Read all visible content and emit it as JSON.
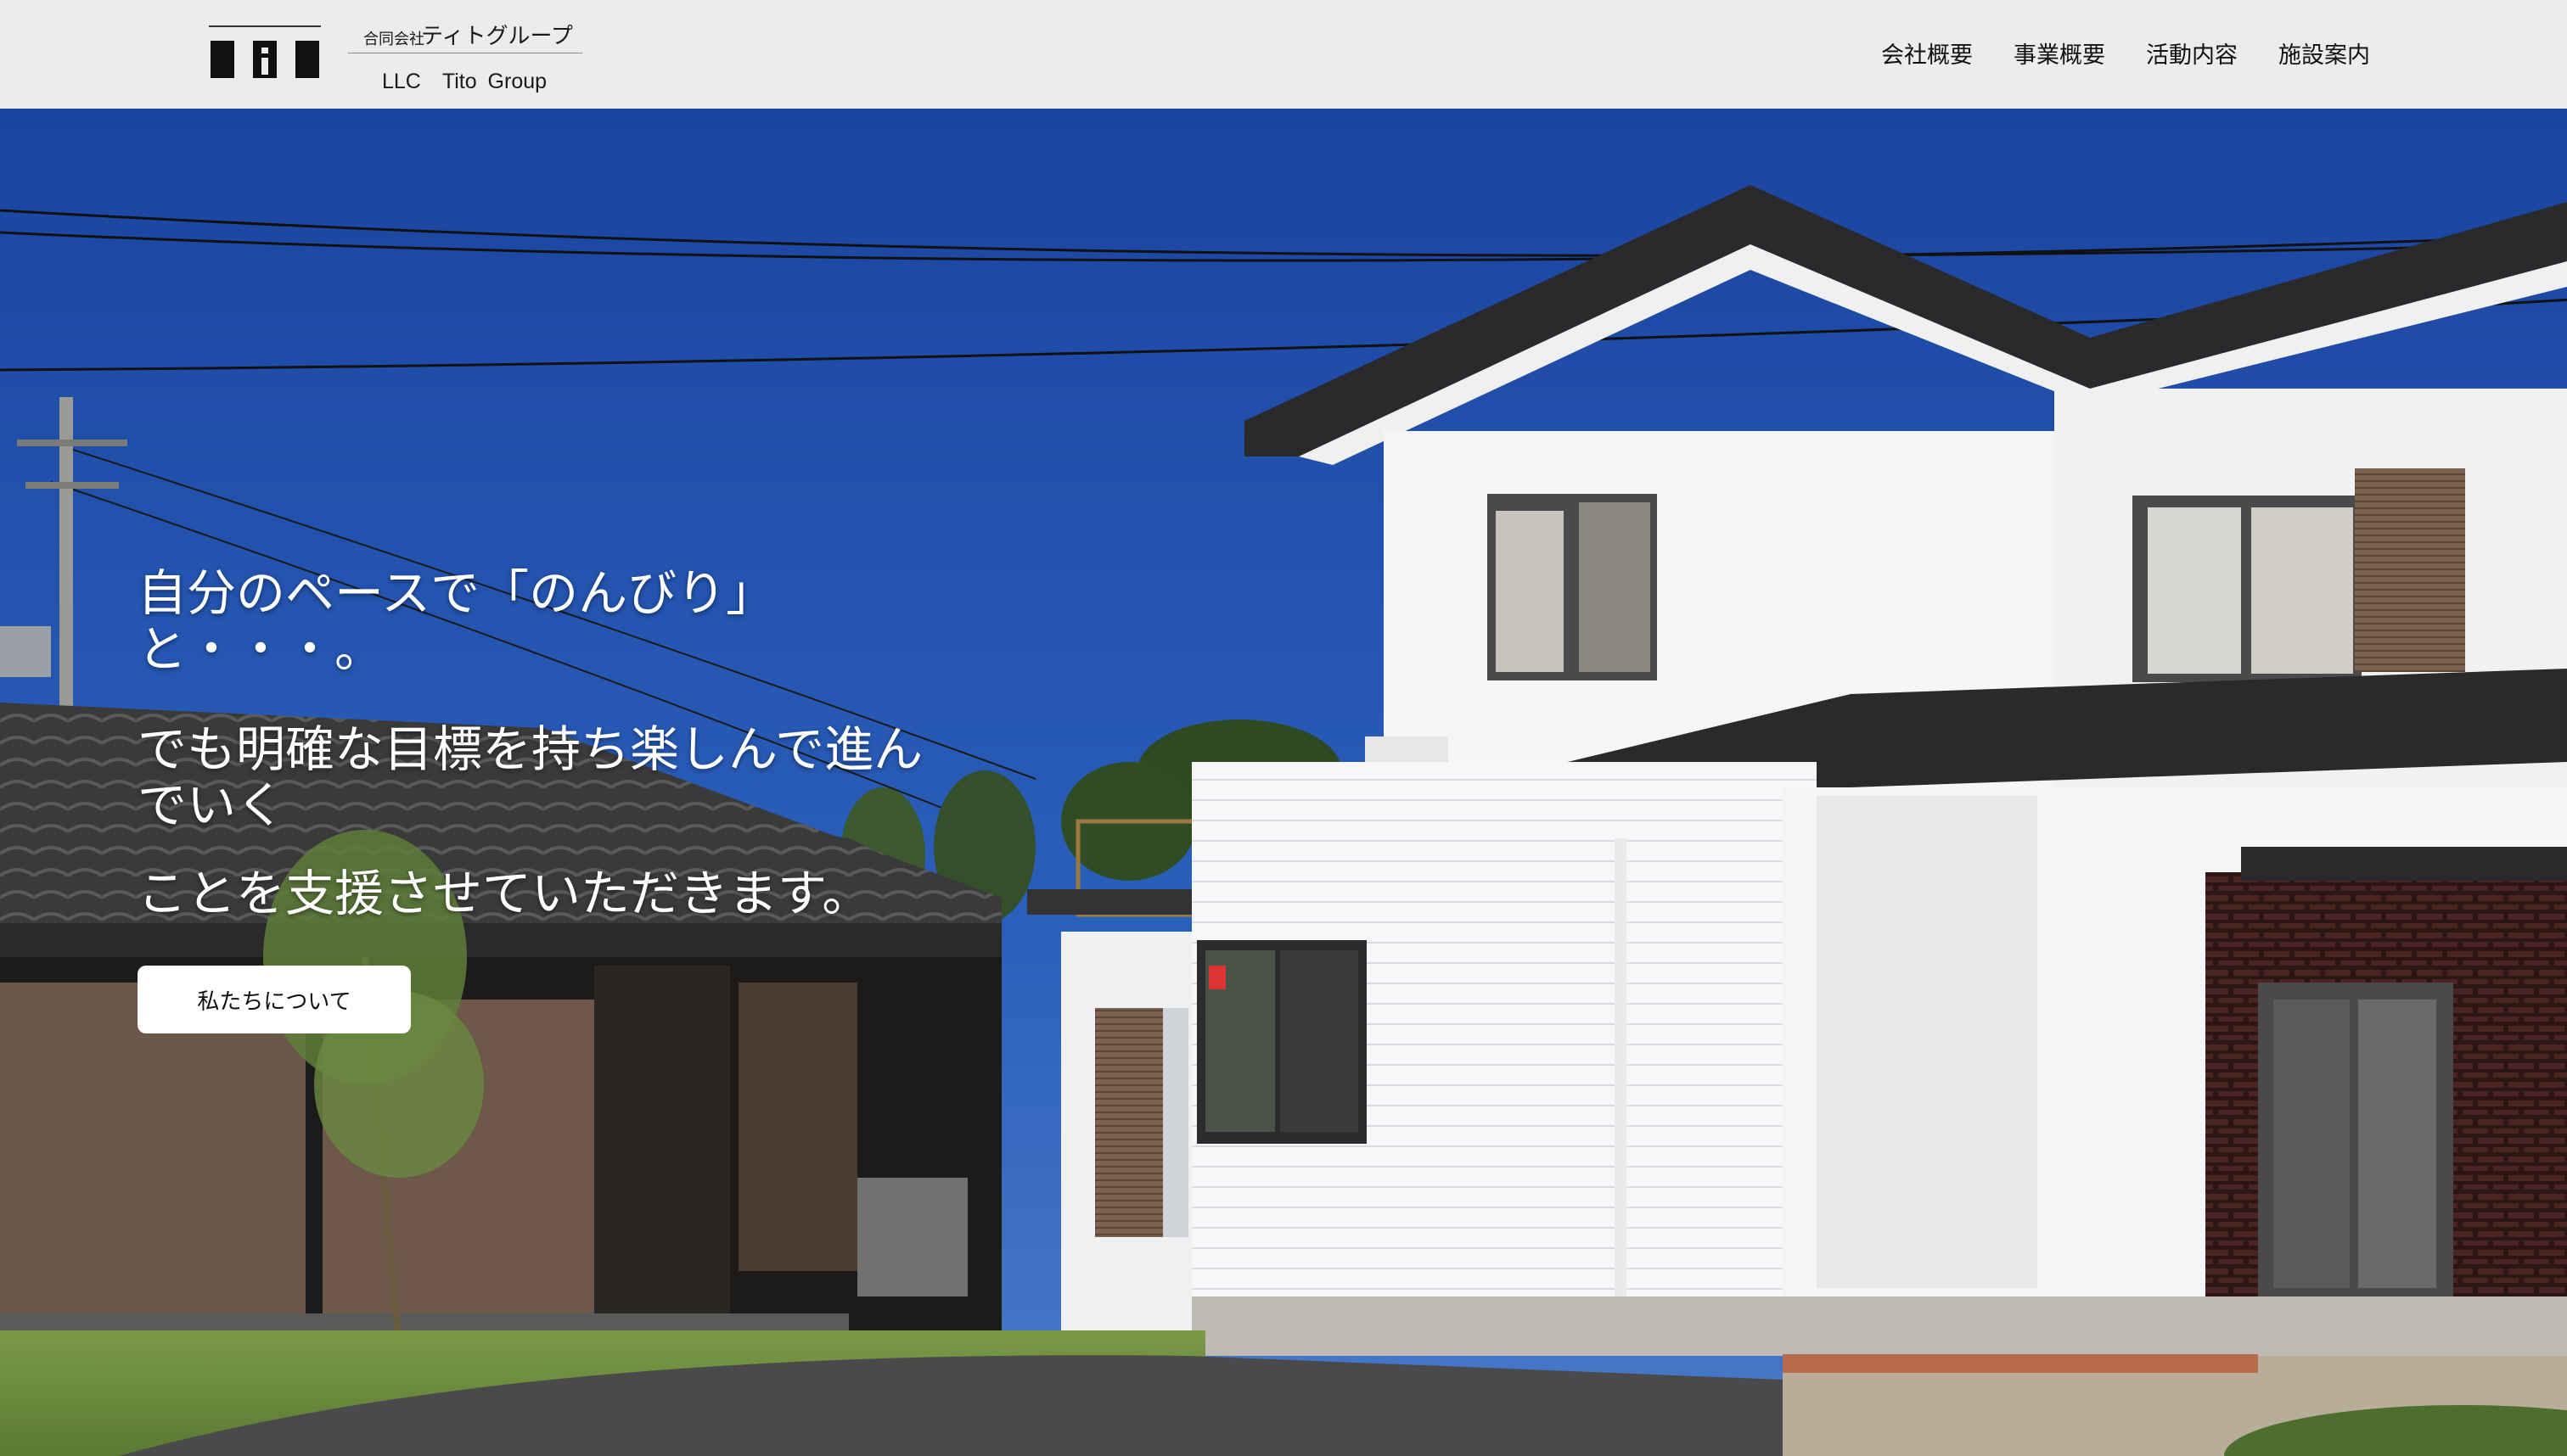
{
  "header": {
    "logo": {
      "name_jp_prefix": "合同会社",
      "name_jp": "ティトグループ",
      "name_en": "LLC　Tito Group"
    },
    "nav": [
      {
        "label": "会社概要"
      },
      {
        "label": "事業概要"
      },
      {
        "label": "活動内容"
      },
      {
        "label": "施設案内"
      }
    ]
  },
  "hero": {
    "line1": "自分のペースで「のんびり」\nと・・・。",
    "line2": "でも明確な目標を持ち楽しんで進ん\nでいく",
    "line3": "ことを支援させていただきます。",
    "button_label": "私たちについて"
  },
  "colors": {
    "header_bg": "#ececec",
    "sky": "#1d4fa8",
    "text_on_hero": "#ffffff"
  }
}
